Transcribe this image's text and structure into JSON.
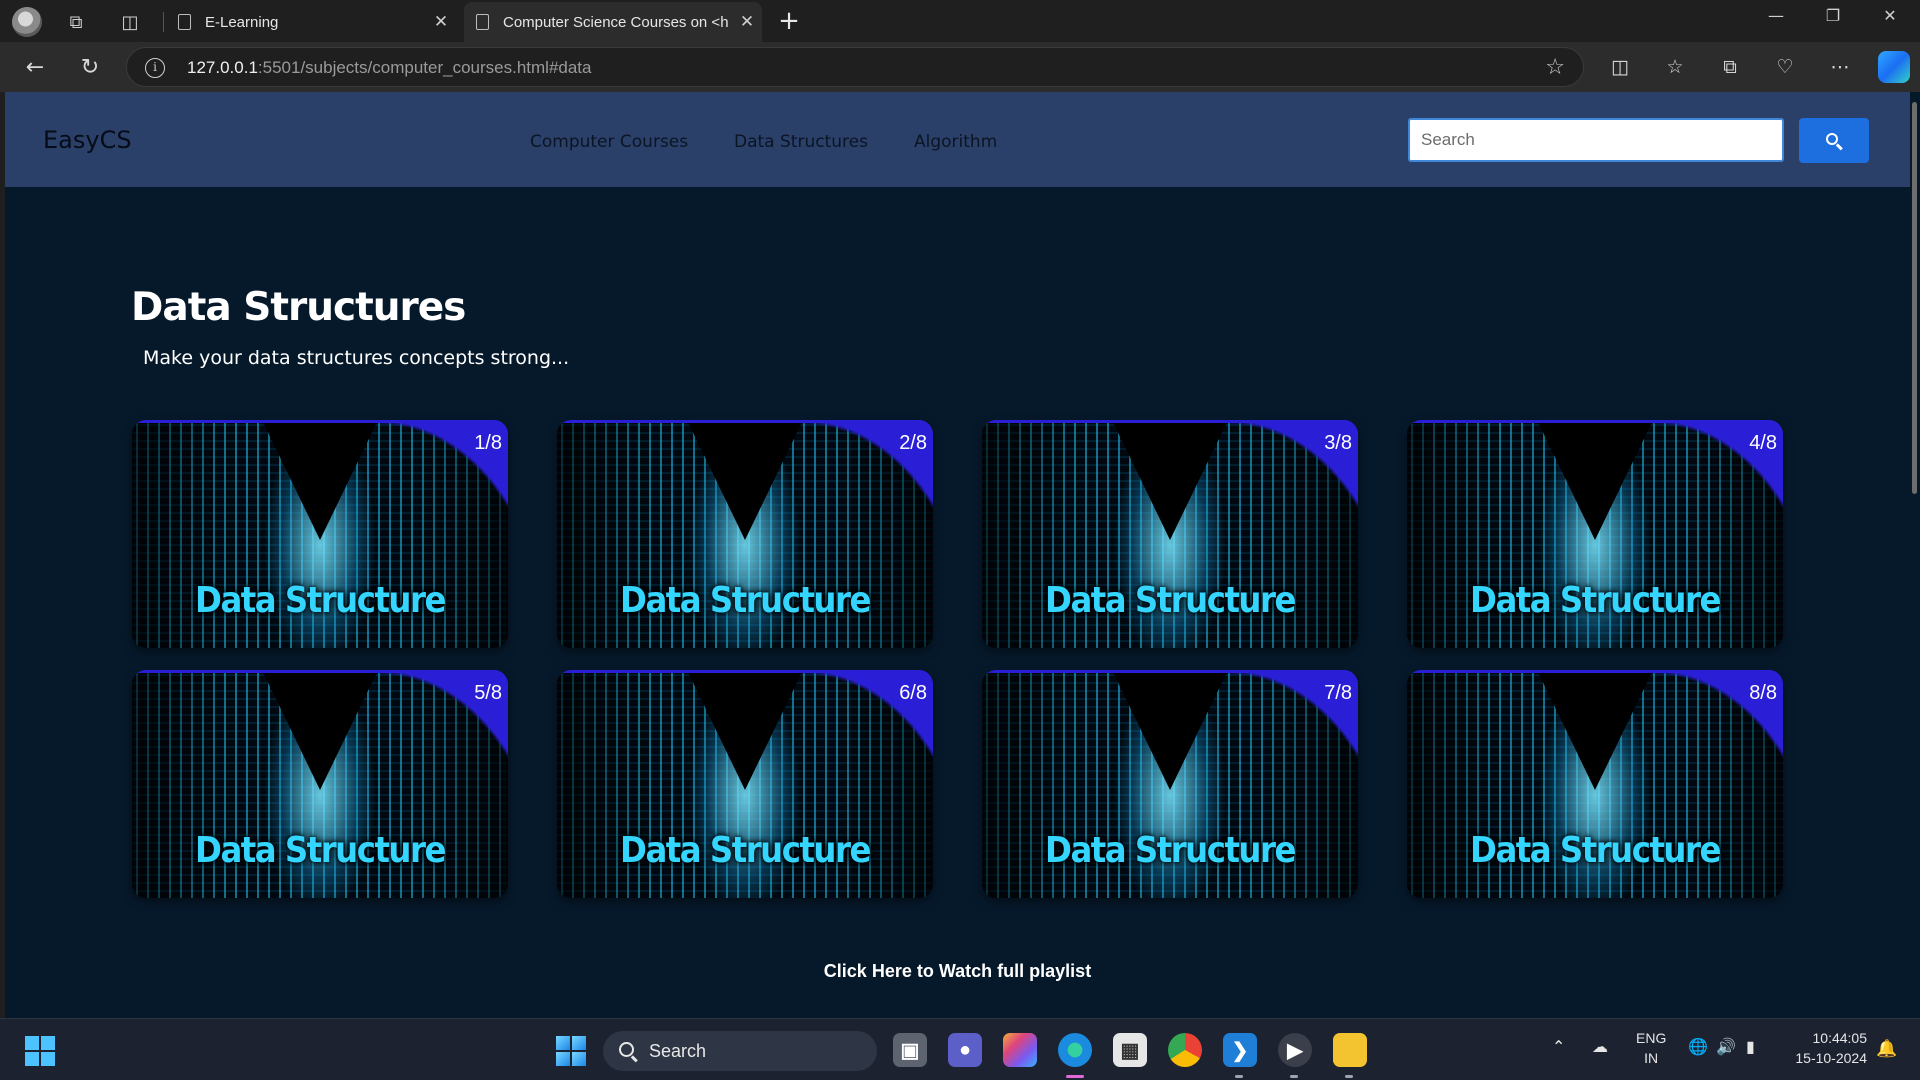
{
  "browser": {
    "tabs": [
      {
        "title": "E-Learning",
        "active": false
      },
      {
        "title": "Computer Science Courses on <h",
        "active": true
      }
    ],
    "url": {
      "host": "127.0.0.1",
      "path": ":5501/subjects/computer_courses.html#data"
    }
  },
  "site": {
    "brand": "EasyCS",
    "nav": [
      "Computer Courses",
      "Data Structures",
      "Algorithm"
    ],
    "search_placeholder": "Search"
  },
  "section": {
    "title": "Data Structures",
    "subtitle": "Make your data structures concepts strong...",
    "cards": [
      {
        "counter": "1/8",
        "caption": "Data Structure"
      },
      {
        "counter": "2/8",
        "caption": "Data Structure"
      },
      {
        "counter": "3/8",
        "caption": "Data Structure"
      },
      {
        "counter": "4/8",
        "caption": "Data Structure"
      },
      {
        "counter": "5/8",
        "caption": "Data Structure"
      },
      {
        "counter": "6/8",
        "caption": "Data Structure"
      },
      {
        "counter": "7/8",
        "caption": "Data Structure"
      },
      {
        "counter": "8/8",
        "caption": "Data Structure"
      }
    ],
    "playlist_link": "Click Here to Watch full playlist"
  },
  "taskbar": {
    "search_label": "Search",
    "lang": [
      "ENG",
      "IN"
    ],
    "time": "10:44:05",
    "date": "15-10-2024"
  },
  "colors": {
    "page_bg": "#06192b",
    "navbar_bg": "#2b4068",
    "search_button": "#1d6fe0",
    "card_corner": "#2a1fd6"
  }
}
